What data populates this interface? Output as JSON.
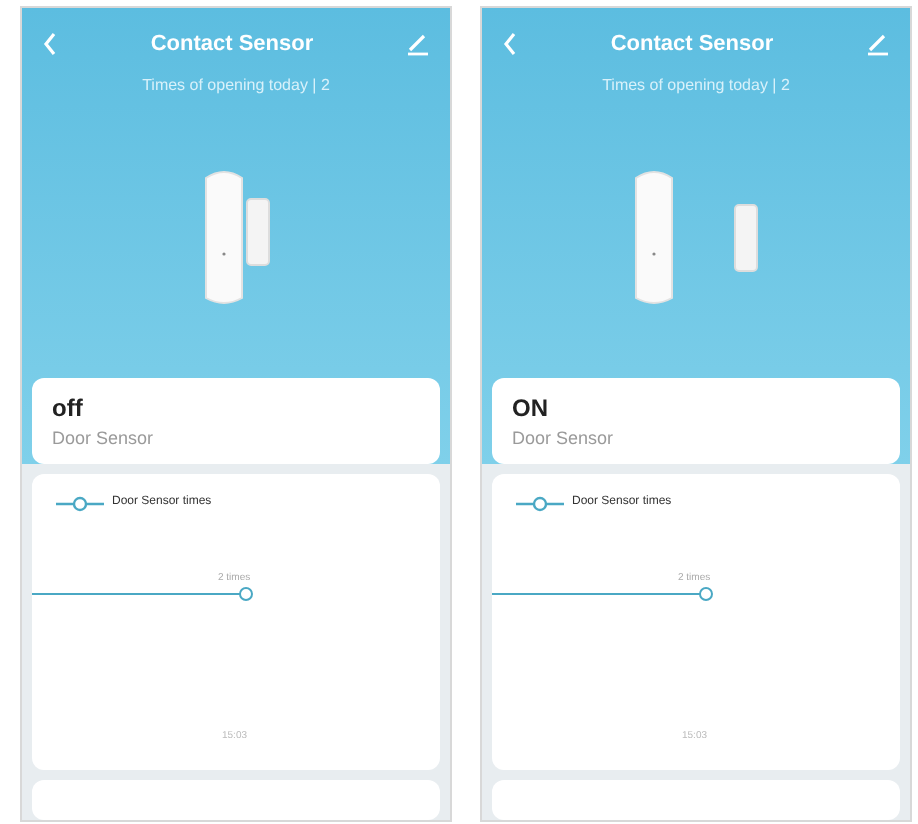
{
  "screens": [
    {
      "title": "Contact Sensor",
      "subtitle": "Times of opening today | 2",
      "magnet_apart": false,
      "status": "off",
      "device": "Door Sensor",
      "legend": "Door Sensor times",
      "point_label": "2 times",
      "time_label": "15:03"
    },
    {
      "title": "Contact Sensor",
      "subtitle": "Times of opening today | 2",
      "magnet_apart": true,
      "status": "ON",
      "device": "Door Sensor",
      "legend": "Door Sensor times",
      "point_label": "2 times",
      "time_label": "15:03"
    }
  ]
}
